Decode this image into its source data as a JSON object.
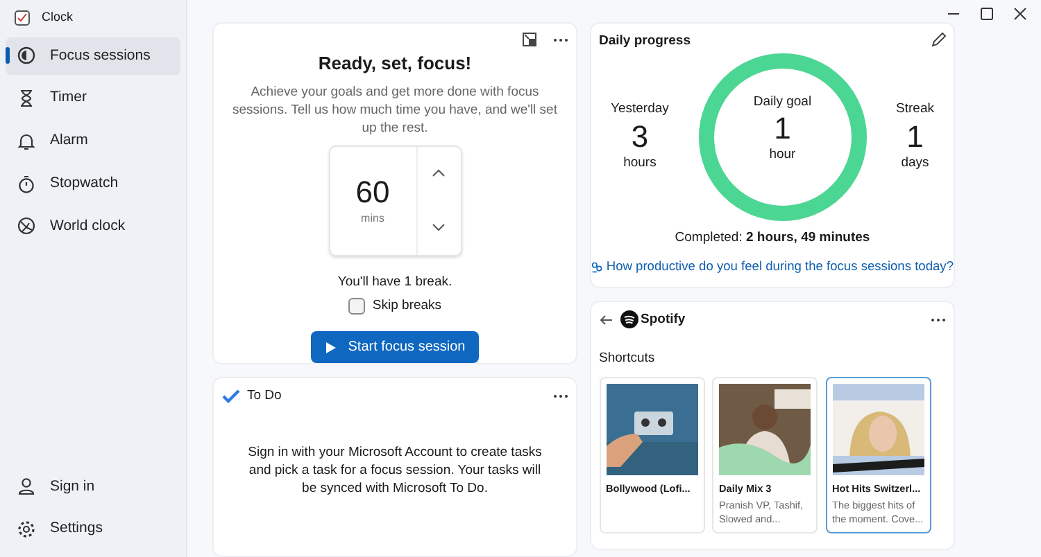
{
  "window": {
    "title": "Clock"
  },
  "sidebar": {
    "items": [
      {
        "label": "Focus sessions",
        "selected": true
      },
      {
        "label": "Timer",
        "selected": false
      },
      {
        "label": "Alarm",
        "selected": false
      },
      {
        "label": "Stopwatch",
        "selected": false
      },
      {
        "label": "World clock",
        "selected": false
      }
    ],
    "footer": [
      {
        "label": "Sign in"
      },
      {
        "label": "Settings"
      }
    ]
  },
  "focus_card": {
    "title": "Ready, set, focus!",
    "description": "Achieve your goals and get more done with focus sessions. Tell us how much time you have, and we'll set up the rest.",
    "minutes": "60",
    "unit": "mins",
    "breaks_note": "You'll have 1 break.",
    "skip_breaks": {
      "label": "Skip breaks",
      "checked": false
    },
    "start_button": "Start focus session"
  },
  "todo_card": {
    "title": "To Do",
    "message": "Sign in with your Microsoft Account to create tasks and pick a task for a focus session. Your tasks will be synced with Microsoft To Do."
  },
  "daily_progress": {
    "title": "Daily progress",
    "yesterday": {
      "label": "Yesterday",
      "value": "3",
      "unit": "hours"
    },
    "goal": {
      "label": "Daily goal",
      "value": "1",
      "unit": "hour",
      "level": 1
    },
    "streak": {
      "label": "Streak",
      "value": "1",
      "unit": "days"
    },
    "completed": "Completed: **2 hours, 49 minutes**",
    "feedback_link": "How productive do you feel during the focus sessions today?"
  },
  "spotify": {
    "brand": "Spotify",
    "section": "Shortcuts",
    "shortcuts": [
      {
        "title": "Bollywood (Lofi...",
        "selected": false
      },
      {
        "title": "Daily Mix 3",
        "subtitle": "Pranish VP, Tashif, Slowed and...",
        "selected": false
      },
      {
        "title": "Hot Hits Switzerl...",
        "subtitle": "The biggest hits of the moment. Cove...",
        "selected": true
      }
    ]
  }
}
